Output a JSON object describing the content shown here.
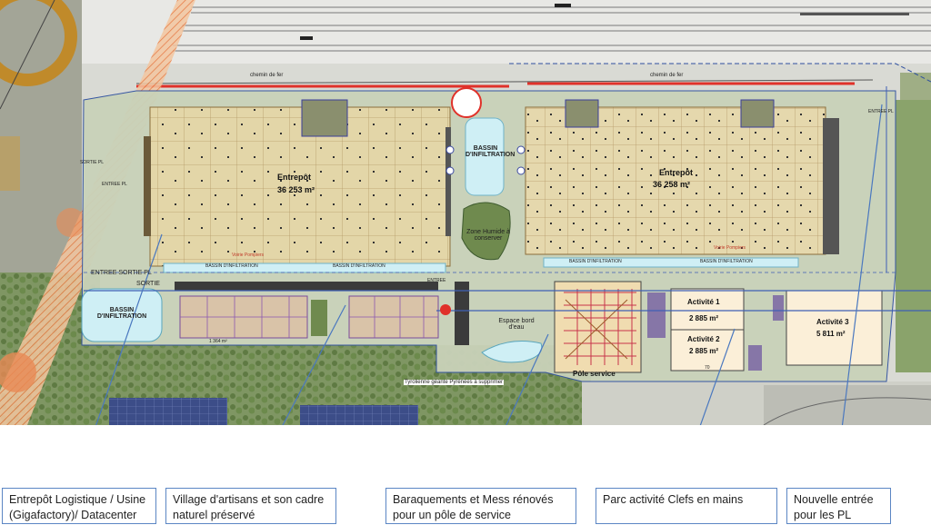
{
  "map_labels": {
    "chemin_de_fer_1": "chemin de fer",
    "chemin_de_fer_2": "chemin de fer",
    "entrepot_1_name": "Entrepôt",
    "entrepot_1_area": "36 253 m²",
    "entrepot_2_name": "Entrepôt",
    "entrepot_2_area": "36 258 m²",
    "bassin_center": "BASSIN D'INFILTRATION",
    "bassin_left": "BASSIN D'INFILTRATION",
    "bassin_strip_1": "BASSIN D'INFILTRATION",
    "bassin_strip_2": "BASSIN D'INFILTRATION",
    "bassin_strip_3": "BASSIN D'INFILTRATION",
    "bassin_strip_4": "BASSIN D'INFILTRATION",
    "zone_humide": "Zone Humide à conserver",
    "voirie_pompiers_1": "Voirie Pompiers",
    "voirie_pompiers_2": "Voirie Pompiers",
    "entree_sortie_pl": "ENTREE SORTIE PL",
    "sortie": "SORTIE",
    "sortie_left": "SORTIE PL",
    "entree_left": "ENTREE PL",
    "entree_right": "ENTREE PL",
    "entree_small": "ENTREE",
    "espace_bord_eau": "Espace bord d'eau",
    "pole_service": "Pôle service",
    "activite_1_name": "Activité 1",
    "activite_1_area": "2 885 m²",
    "activite_2_name": "Activité 2",
    "activite_2_area": "2 885 m²",
    "activite_3_name": "Activité 3",
    "activite_3_area": "5 811 m²",
    "tyrolienne": "Tyrolienne géante Pyrénées à supprimer",
    "small_area": "1 364 m²",
    "dim_70": "70"
  },
  "callouts": [
    {
      "line1": "Entrepôt Logistique / Usine",
      "line2": "(Gigafactory)/ Datacenter"
    },
    {
      "line1": "Village d'artisans et son cadre",
      "line2": "naturel préservé"
    },
    {
      "line1": "Baraquements et Mess rénovés",
      "line2": "pour un pôle de service"
    },
    {
      "line1": "Parc activité Clefs en mains",
      "line2": ""
    },
    {
      "line1": "Nouvelle entrée",
      "line2": "pour les PL"
    }
  ],
  "colors": {
    "warehouse_fill": "#e3d6a8",
    "water": "#cfeff5",
    "railway_red": "#e0312a",
    "callout_line": "#4a78bf",
    "vegetation": "#6f8a4e"
  }
}
